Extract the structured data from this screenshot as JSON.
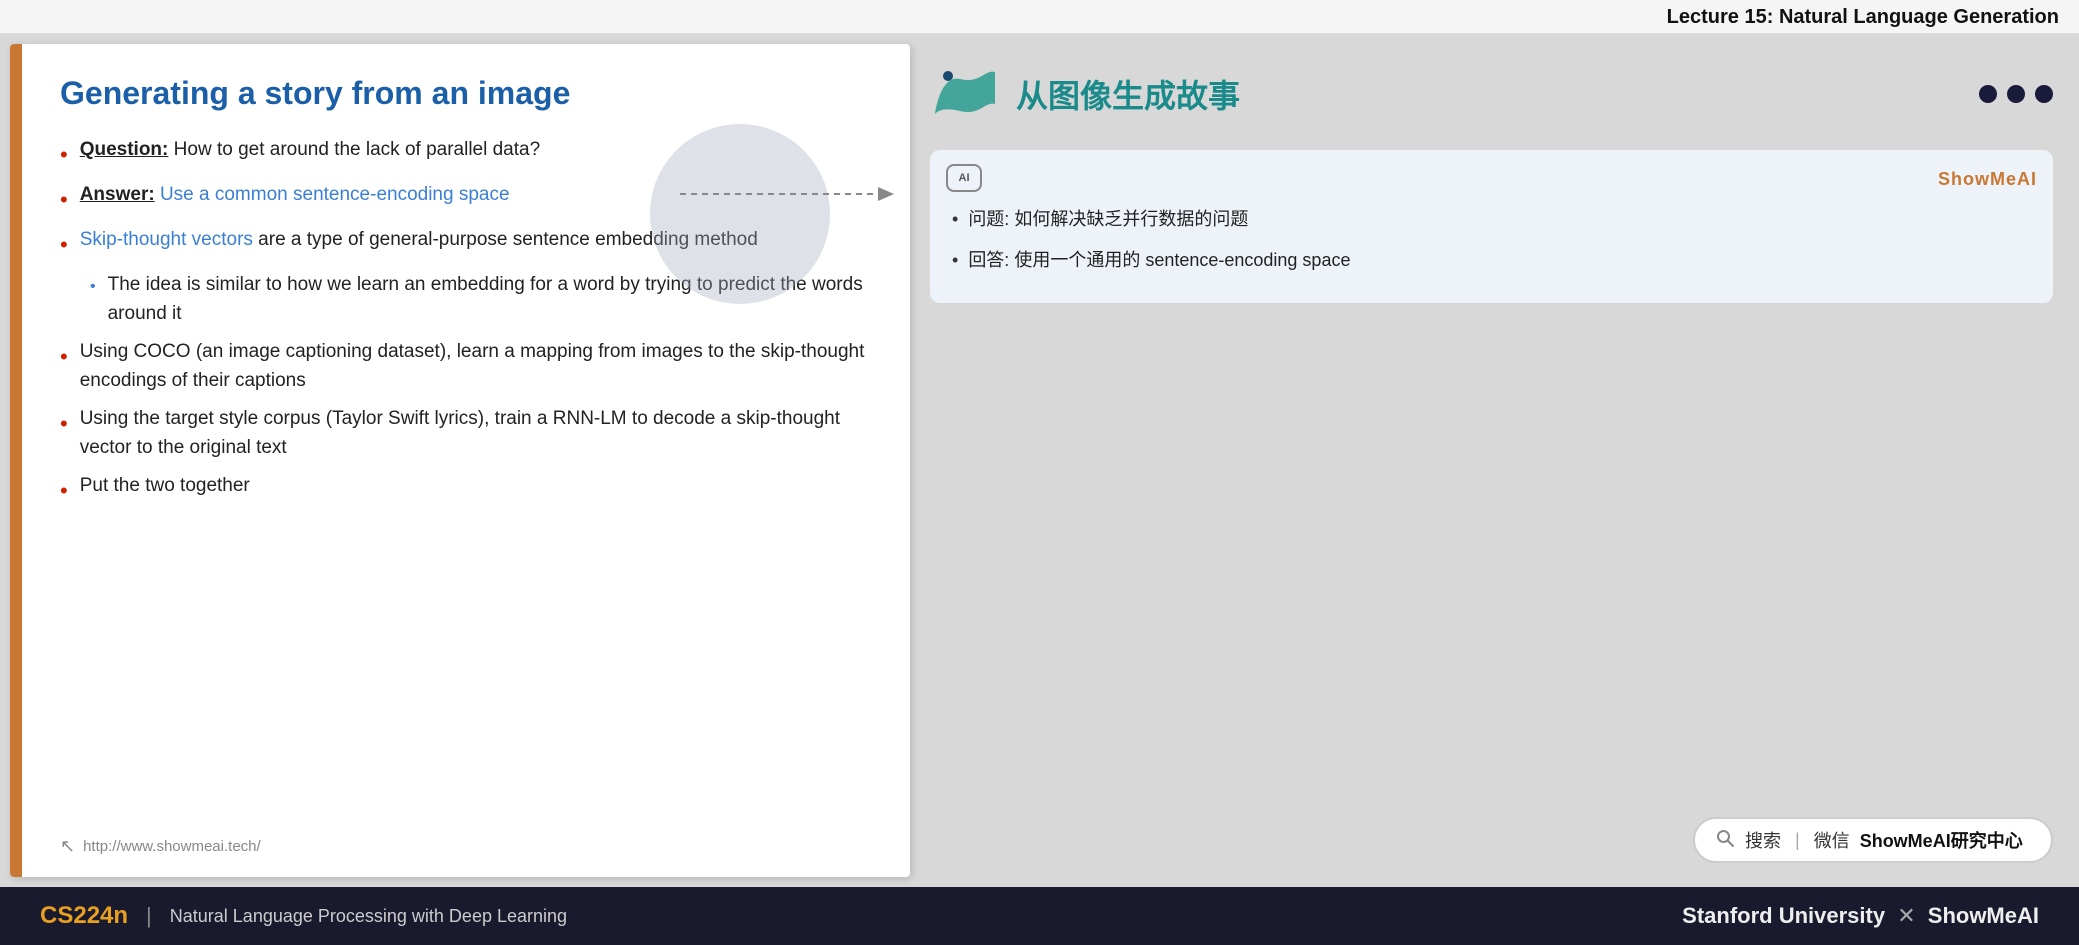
{
  "header": {
    "title": "Lecture 15: Natural Language Generation"
  },
  "slide": {
    "title": "Generating a story from an image",
    "bullet1_label": "Question:",
    "bullet1_text": " How to get around the lack of parallel data?",
    "bullet2_label": "Answer:",
    "bullet2_text": " Use a common sentence-encoding space",
    "bullet3_text": "Skip-thought vectors",
    "bullet3_rest": " are a type of general-purpose sentence embedding method",
    "subbullet1": "The idea is similar to how we learn an embedding for a word by trying to predict the words around it",
    "bullet4": "Using COCO (an image captioning dataset), learn a mapping from images to the skip-thought encodings of their captions",
    "bullet5": "Using the target style corpus (Taylor Swift lyrics), train a RNN-LM to decode a skip-thought vector to the original text",
    "bullet6": "Put the two together",
    "footer_url": "http://www.showmeai.tech/"
  },
  "right_panel": {
    "chinese_title": "从图像生成故事",
    "nav_dots": [
      "dark",
      "dark",
      "dark"
    ],
    "translation_brand": "ShowMeAI",
    "translation_ai_label": "AI",
    "trans_bullet1": "问题: 如何解决缺乏并行数据的问题",
    "trans_bullet2": "回答: 使用一个通用的 sentence-encoding space",
    "search_placeholder": "搜索 | 微信 ShowMeAI研究中心"
  },
  "footer": {
    "cs_label": "CS224n",
    "subtitle": "Natural Language Processing with Deep Learning",
    "stanford": "Stanford University",
    "x_symbol": "✕",
    "showmeai": "ShowMeAI"
  }
}
